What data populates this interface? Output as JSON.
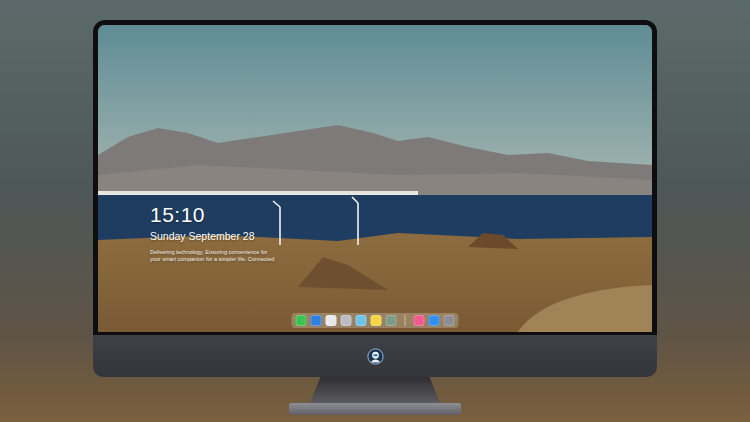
{
  "screen": {
    "time": "15:10",
    "date": "Sunday September 28",
    "caption": [
      "Delivering technology, Ensuring convenience for",
      "your smart companion for a simpler life. Connected"
    ],
    "dock": {
      "pinned": [
        {
          "color": "#3cc24f"
        },
        {
          "color": "#2f7fe0"
        },
        {
          "color": "#e8e8ea"
        },
        {
          "color": "#b9bcc2"
        },
        {
          "color": "#6fc3e8"
        },
        {
          "color": "#f5d547"
        },
        {
          "color": "#7f9b86"
        }
      ],
      "recent": [
        {
          "color": "#f05a8c"
        },
        {
          "color": "#2f8ef0"
        },
        {
          "color": "#8d8d93"
        }
      ]
    }
  }
}
